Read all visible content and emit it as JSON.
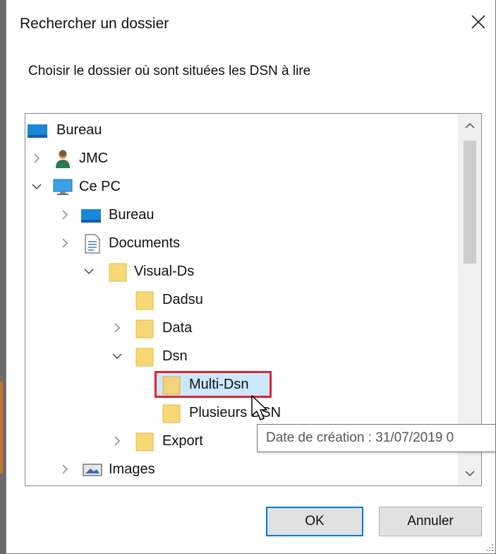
{
  "dialog": {
    "title": "Rechercher un dossier",
    "instruction": "Choisir le dossier où sont situées les DSN à lire",
    "ok_label": "OK",
    "cancel_label": "Annuler"
  },
  "tree": {
    "items": [
      {
        "label": "Bureau",
        "icon": "desktop-icon"
      },
      {
        "label": "JMC",
        "icon": "user-icon"
      },
      {
        "label": "Ce PC",
        "icon": "computer-icon"
      },
      {
        "label": "Bureau",
        "icon": "desktop-icon"
      },
      {
        "label": "Documents",
        "icon": "document-icon"
      },
      {
        "label": "Visual-Ds",
        "icon": "folder-icon"
      },
      {
        "label": "Dadsu",
        "icon": "folder-icon"
      },
      {
        "label": "Data",
        "icon": "folder-icon"
      },
      {
        "label": "Dsn",
        "icon": "folder-icon"
      },
      {
        "label": "Multi-Dsn",
        "icon": "folder-icon",
        "selected": true
      },
      {
        "label": "Plusieurs DSN",
        "icon": "folder-icon"
      },
      {
        "label": "Export",
        "icon": "folder-icon"
      },
      {
        "label": "Images",
        "icon": "pictures-icon"
      }
    ]
  },
  "tooltip": {
    "text": "Date de création : 31/07/2019 0"
  },
  "colors": {
    "selection": "#cce8ff",
    "highlight_border": "#e0232e",
    "ok_border": "#0078d7",
    "folder": "#f8d775"
  }
}
